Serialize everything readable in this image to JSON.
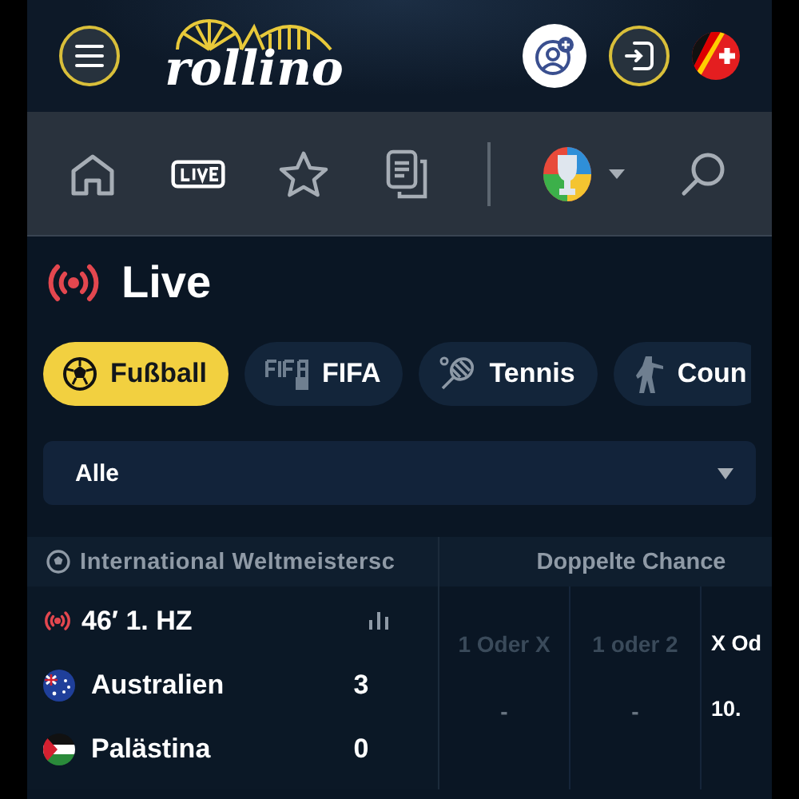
{
  "header": {
    "logo": "rollino"
  },
  "section": {
    "title": "Live"
  },
  "sports": [
    {
      "label": "Fußball",
      "selected": true
    },
    {
      "label": "FIFA",
      "selected": false
    },
    {
      "label": "Tennis",
      "selected": false
    },
    {
      "label": "Coun",
      "selected": false
    }
  ],
  "filter": {
    "value": "Alle"
  },
  "table": {
    "league": "International Weltmeistersc",
    "market": "Doppelte Chance",
    "match": {
      "time": "46′ 1. HZ",
      "teams": [
        {
          "name": "Australien",
          "score": "3"
        },
        {
          "name": "Palästina",
          "score": "0"
        }
      ],
      "odds": [
        {
          "label": "1 Oder X",
          "value": "-",
          "disabled": true
        },
        {
          "label": "1 oder 2",
          "value": "-",
          "disabled": true
        },
        {
          "label": "X Od",
          "value": "10.",
          "disabled": false
        }
      ]
    }
  }
}
